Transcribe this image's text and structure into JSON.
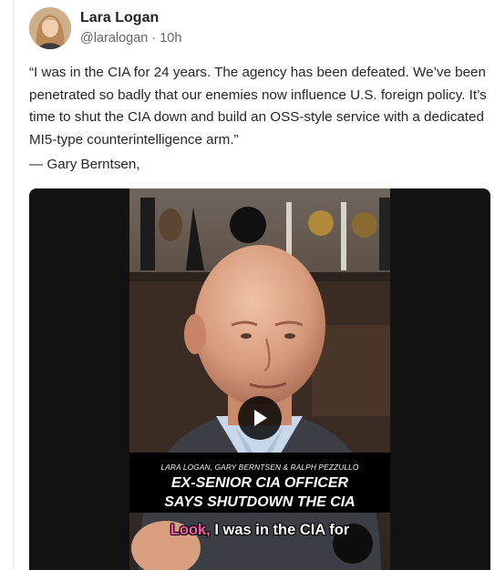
{
  "author": {
    "name": "Lara Logan",
    "handle": "@laralogan",
    "separator": "·",
    "time": "10h"
  },
  "post": {
    "text": "“I was in the CIA for 24 years. The agency has been defeated. We’ve been penetrated so badly that our enemies now influence U.S. foreign policy. It’s time to shut the CIA down and build an OSS-style service with a dedicated MI5-type counterintelligence arm.”",
    "attribution": "— Gary Berntsen,"
  },
  "video": {
    "banner_names": "LARA LOGAN, GARY BERNTSEN & RALPH PEZZULLO",
    "banner_title_line1": "EX-SENIOR CIA OFFICER",
    "banner_title_line2": "SAYS SHUTDOWN THE CIA",
    "caption_highlight": "Look,",
    "caption_rest": " I was in the CIA for",
    "play_icon": "play-icon",
    "caption_highlight_color": "#ff5bb0"
  }
}
